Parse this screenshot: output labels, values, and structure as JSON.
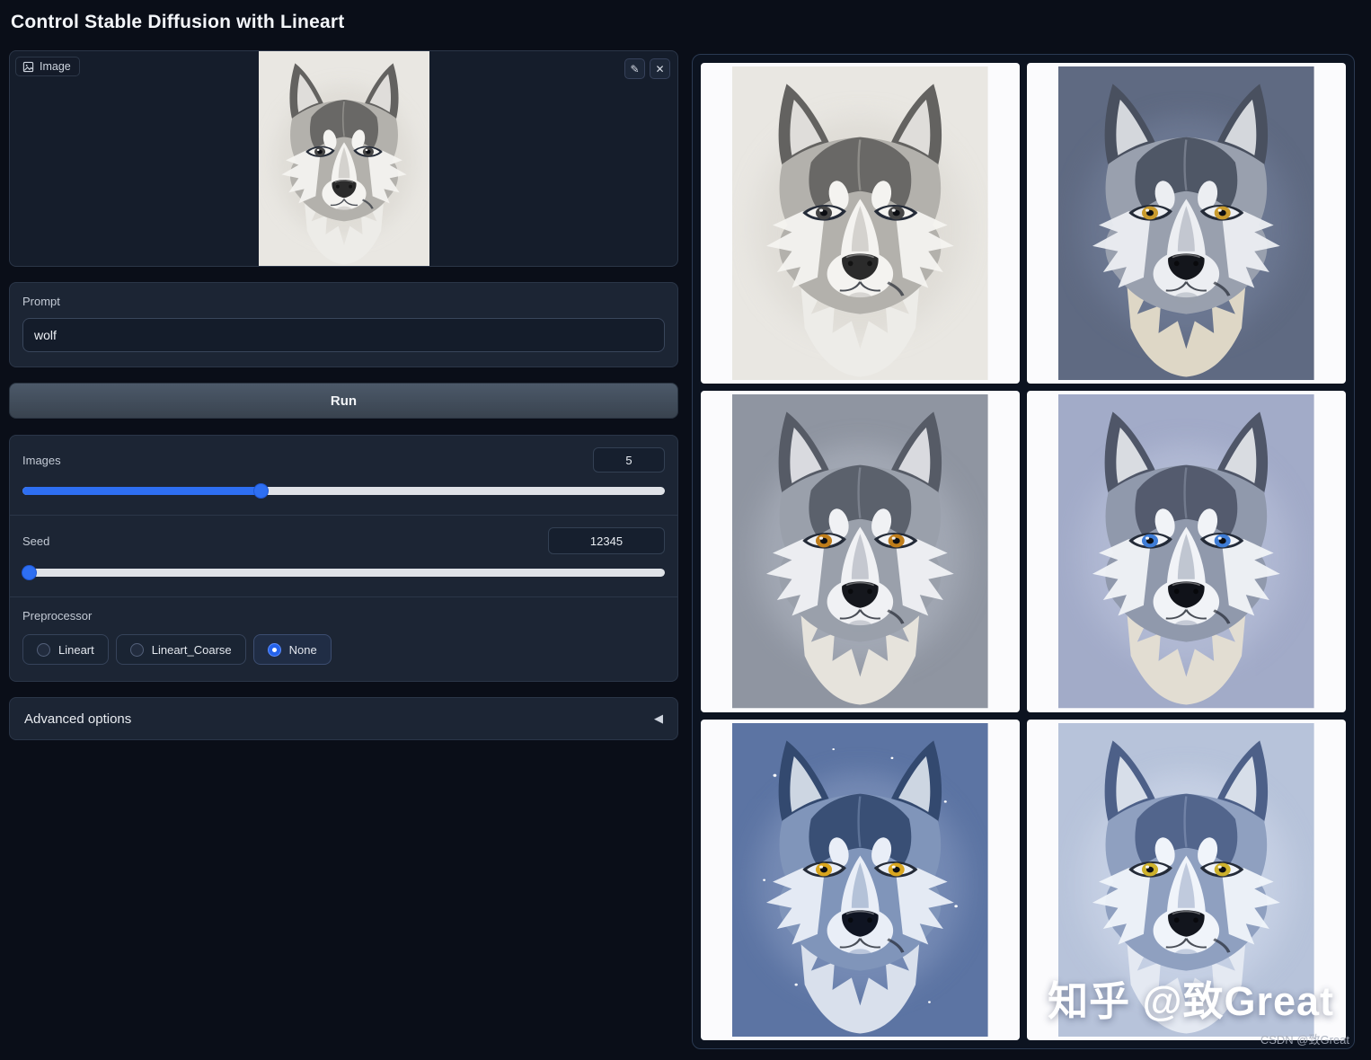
{
  "header": {
    "title": "Control Stable Diffusion with Lineart"
  },
  "input_panel": {
    "image": {
      "label": "Image",
      "edit_icon": "✎",
      "clear_icon": "✕",
      "desc": "wolf head pencil lineart sketch",
      "palette": {
        "bg": "#e9e7e2",
        "halo": "#dcd9d3",
        "dark": "#636260",
        "mid": "#b3b1ac",
        "light": "#f4f3f0",
        "cream": "#edece8",
        "eye": "#454545",
        "nose": "#2b2b2b",
        "stars": "0"
      }
    },
    "prompt": {
      "label": "Prompt",
      "value": "wolf"
    },
    "run_label": "Run",
    "images_slider": {
      "label": "Images",
      "value": "5",
      "percent": 37
    },
    "seed_slider": {
      "label": "Seed",
      "value": "12345",
      "percent": 1
    },
    "preprocessor": {
      "label": "Preprocessor",
      "options": [
        {
          "label": "Lineart",
          "selected": false
        },
        {
          "label": "Lineart_Coarse",
          "selected": false
        },
        {
          "label": "None",
          "selected": true
        }
      ]
    },
    "advanced": {
      "label": "Advanced options",
      "arrow": "◀"
    }
  },
  "gallery": {
    "watermark_large": "知乎 @致Great",
    "watermark_small": "CSDN @致Great",
    "items": [
      {
        "desc": "pencil lineart wolf sketch on paper",
        "palette": {
          "bg": "#e9e7e2",
          "halo": "#dcd9d3",
          "dark": "#636260",
          "mid": "#b3b1ac",
          "light": "#f4f3f0",
          "cream": "#edece8",
          "eye": "#454545",
          "nose": "#2b2b2b",
          "stars": "0"
        }
      },
      {
        "desc": "realistic gray wolf, amber eyes, slate blue background",
        "palette": {
          "bg": "#5f6a82",
          "halo": "#707c96",
          "dark": "#49505f",
          "mid": "#99a0ae",
          "light": "#eceef2",
          "cream": "#ded7c6",
          "eye": "#c89a2d",
          "nose": "#14161c",
          "stars": "0"
        }
      },
      {
        "desc": "soft airbrushed gray wolf, orange eyes, misty gray background",
        "palette": {
          "bg": "#8f95a1",
          "halo": "#a8aeba",
          "dark": "#565b66",
          "mid": "#9aa0ab",
          "light": "#f0f1f4",
          "cream": "#e6e3dc",
          "eye": "#bf7d1a",
          "nose": "#15171d",
          "stars": "0"
        }
      },
      {
        "desc": "husky-like wolf, blue eyes, periwinkle background",
        "palette": {
          "bg": "#a2abc8",
          "halo": "#b5bdd7",
          "dark": "#4f5668",
          "mid": "#9099ac",
          "light": "#f1f3f7",
          "cream": "#e2ddd2",
          "eye": "#3e7cd6",
          "nose": "#101219",
          "stars": "0"
        }
      },
      {
        "desc": "blue-toned wolf, golden eyes, starry night blue background",
        "palette": {
          "bg": "#5c74a3",
          "halo": "#7d91b9",
          "dark": "#33496f",
          "mid": "#8095ba",
          "light": "#e9eef7",
          "cream": "#d9e0ec",
          "eye": "#d9a61f",
          "nose": "#0f1422",
          "stars": "1"
        }
      },
      {
        "desc": "light blue-gray wolf, yellow-green eyes, icy background",
        "palette": {
          "bg": "#b7c3da",
          "halo": "#cad4e7",
          "dark": "#4d6088",
          "mid": "#8fa0c0",
          "light": "#f0f4fa",
          "cream": "#e4e9f2",
          "eye": "#cdb12c",
          "nose": "#12151d",
          "stars": "0"
        }
      }
    ]
  }
}
